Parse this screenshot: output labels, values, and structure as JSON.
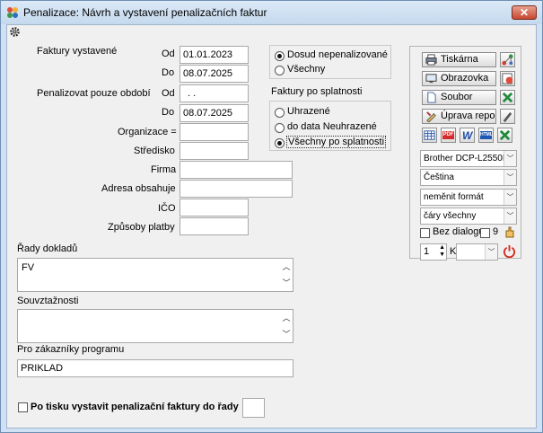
{
  "window": {
    "title": "Penalizace: Návrh a vystavení penalizačních faktur",
    "close_label": "✕"
  },
  "left": {
    "faktury_vystavene_label": "Faktury vystavené",
    "od_label": "Od",
    "do_label": "Do",
    "vystavene_od": "01.01.2023",
    "vystavene_do": "08.07.2025",
    "penalizovat_label": "Penalizovat pouze období",
    "penal_od": " . .",
    "penal_do": "08.07.2025",
    "organizace_label": "Organizace =",
    "stredisko_label": "Středisko",
    "firma_label": "Firma",
    "adresa_label": "Adresa obsahuje",
    "ico_label": "IČO",
    "zpusoby_label": "Způsoby platby",
    "organizace_value": "",
    "stredisko_value": "",
    "firma_value": "",
    "adresa_value": "",
    "ico_value": "",
    "zpusoby_value": ""
  },
  "status_group": {
    "option1": "Dosud nepenalizované",
    "option2": "Všechny",
    "selected": 1
  },
  "splatnost": {
    "title": "Faktury po splatnosti",
    "option1": "Uhrazené",
    "option2": "do data Neuhrazené",
    "option3": "Všechny po splatnosti",
    "selected": 3
  },
  "rady": {
    "label": "Řady dokladů",
    "value": "FV"
  },
  "souvztaznosti": {
    "label": "Souvztažnosti",
    "value": ""
  },
  "zakaznik": {
    "label": "Pro zákazníky programu",
    "value": "PRIKLAD"
  },
  "bottom": {
    "po_tisku_label": "Po tisku vystavit penalizační faktury do řady",
    "rada_value": ""
  },
  "print_panel": {
    "tiskarna": "Tiskárna",
    "obrazovka": "Obrazovka",
    "soubor": "Soubor",
    "uprava": "Úprava repor",
    "printer_combo": "Brother DCP-L2550D",
    "language_combo": "Čeština",
    "format_combo": "neměnit formát",
    "lines_combo": "čáry všechny",
    "bez_dialogu": "Bez dialogu",
    "nine_label": "9",
    "copies": "1",
    "k_label": "K",
    "k_combo": "",
    "pdf_label": "PDF",
    "html_label": "HTML",
    "w_label": "W"
  }
}
